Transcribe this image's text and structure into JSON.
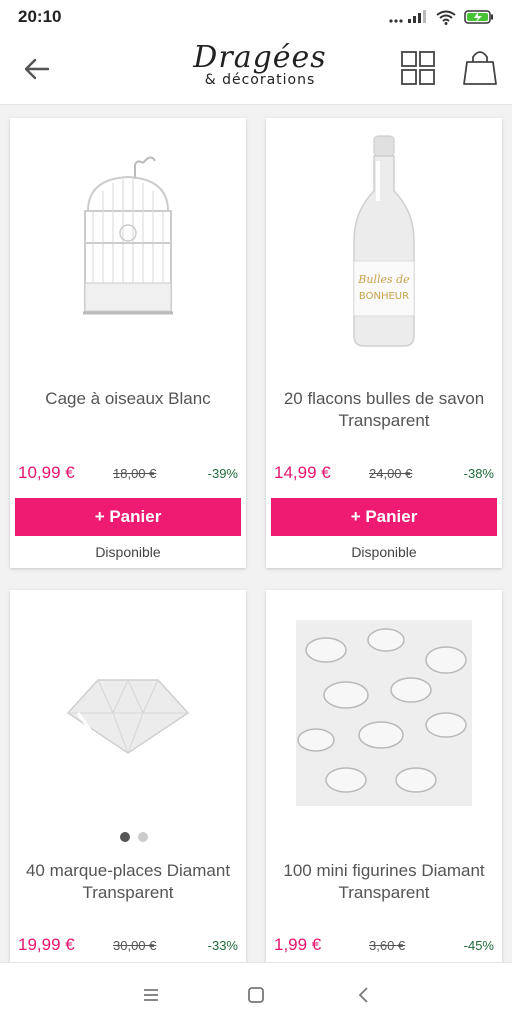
{
  "status": {
    "time": "20:10"
  },
  "header": {
    "logo_main": "Dragées",
    "logo_sub": "& décorations"
  },
  "products": [
    {
      "title": "Cage à oiseaux Blanc",
      "price": "10,99 €",
      "old_price": "18,00 €",
      "discount": "-39%",
      "button": "+ Panier",
      "availability": "Disponible"
    },
    {
      "title": "20 flacons bulles de savon Transparent",
      "price": "14,99 €",
      "old_price": "24,00 €",
      "discount": "-38%",
      "button": "+ Panier",
      "availability": "Disponible",
      "bottle_label_1": "Bulles de",
      "bottle_label_2": "BONHEUR"
    },
    {
      "title": "40 marque-places Diamant Transparent",
      "price": "19,99 €",
      "old_price": "30,00 €",
      "discount": "-33%"
    },
    {
      "title": "100 mini figurines Diamant Transparent",
      "price": "1,99 €",
      "old_price": "3,60 €",
      "discount": "-45%"
    }
  ],
  "colors": {
    "accent": "#ef1a72",
    "price": "#e6166f",
    "discount": "#1f6b3a"
  },
  "icons": [
    "back-arrow-icon",
    "grid-view-icon",
    "shopping-bag-icon",
    "menu-icon",
    "home-icon",
    "back-icon"
  ]
}
